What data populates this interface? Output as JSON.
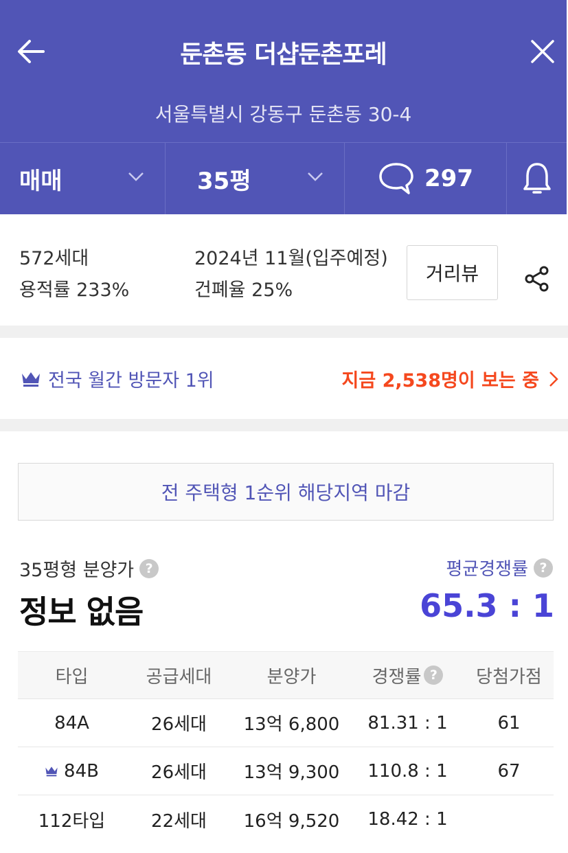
{
  "header": {
    "title": "둔촌동 더샵둔촌포레",
    "address": "서울특별시 강동구 둔촌동 30-4",
    "deal_type": "매매",
    "size": "35평",
    "comment_count": "297",
    "bg_color": "#5155b6"
  },
  "info": {
    "households": "572세대",
    "floor_area_ratio": "용적률 233%",
    "move_in": "2024년 11월(입주예정)",
    "building_coverage": "건폐율 25%",
    "street_view_label": "거리뷰"
  },
  "visitor": {
    "rank_text": "전국 월간 방문자 1위",
    "viewing_text": "지금 2,538명이 보는 중"
  },
  "notice": "전 주택형 1순위 해당지역 마감",
  "price": {
    "label": "35평형 분양가",
    "value": "정보 없음",
    "avg_label": "평균경쟁률",
    "avg_value": "65.3 : 1"
  },
  "table": {
    "headers": [
      "타입",
      "공급세대",
      "분양가",
      "경쟁률",
      "당첨가점"
    ],
    "rows": [
      [
        "84A",
        "26세대",
        "13억 6,800",
        "81.31 : 1",
        "61"
      ],
      [
        "84B",
        "26세대",
        "13억 9,300",
        "110.8 : 1",
        "67"
      ],
      [
        "112타입",
        "22세대",
        "16억 9,520",
        "18.42 : 1",
        ""
      ]
    ]
  },
  "icons": [
    "back-arrow-icon",
    "close-icon",
    "chevron-down-icon",
    "comment-icon",
    "bell-icon",
    "share-icon",
    "crown-icon",
    "chevron-right-icon",
    "help-icon"
  ]
}
